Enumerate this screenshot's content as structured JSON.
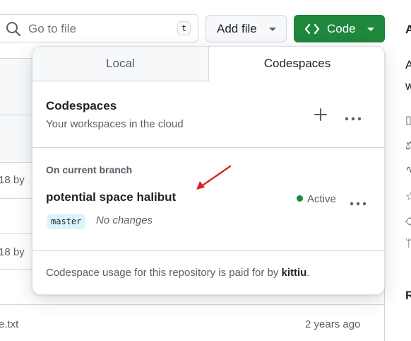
{
  "toolbar": {
    "search_placeholder": "Go to file",
    "search_shortcut": "t",
    "add_file_label": "Add file",
    "code_label": "Code"
  },
  "background": {
    "commit_fragment_1": "18 by",
    "commit_fragment_2": "18 by",
    "file_fragment": "e.txt",
    "time_fragment": "2 years ago",
    "right_letter_1": "A",
    "right_letter_2": "A",
    "right_letter_3": "w",
    "right_letter_4": "R"
  },
  "dropdown": {
    "tabs": [
      {
        "label": "Local",
        "selected": false
      },
      {
        "label": "Codespaces",
        "selected": true
      }
    ],
    "title": "Codespaces",
    "subtitle": "Your workspaces in the cloud",
    "section_heading": "On current branch",
    "codespace": {
      "name": "potential space halibut",
      "status": "Active",
      "branch": "master",
      "changes": "No changes"
    },
    "footer_prefix": "Codespace usage for this repository is paid for by",
    "footer_owner": "kittiu",
    "footer_suffix": "."
  },
  "colors": {
    "code_button": "#1f883d",
    "active_dot": "#1f883d",
    "annotation_arrow": "#e02020",
    "branch_badge": "#ddf4ff"
  },
  "icons": [
    "search-icon",
    "code-icon",
    "plus-icon",
    "kebab-icon",
    "annotation-arrow"
  ]
}
